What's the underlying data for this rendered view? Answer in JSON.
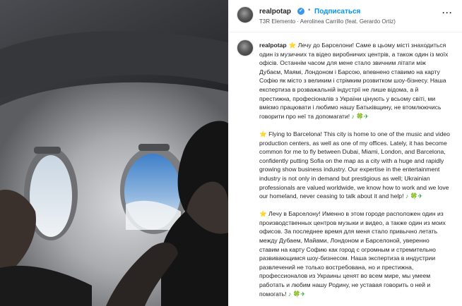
{
  "post": {
    "username": "realpotap",
    "verified_icon": "verified-badge-icon",
    "separator": "•",
    "follow_label": "Подписаться",
    "audio_label": "T3R Elemento · Aerolinea Carrillo (feat. Gerardo Ortiz)",
    "more_label": "···"
  },
  "caption": {
    "username": "realpotap",
    "paragraphs": [
      {
        "lead": "⭐",
        "text": " Лечу до Барселони! Саме в цьому місті знаходиться один із музичних та відео виробничих центрів, а також один із моїх офісів. Останнім часом для мене стало звичним літати між Дубаєм, Маямі, Лондоном і Барсою, впевнено ставимо на карту Софію як місто з великим і стрімким розвитком шоу-бізнесу. Наша експертиза в розважальній індустрії не лише відома, а й престижна, професіоналів з України цінують у всьому світі, ми вміємо працювати і любимо нашу Батьківщину, не втомлюючись говорити про неї та допомагати! ",
        "tail": "♪ 🍀✈"
      },
      {
        "lead": "⭐",
        "text": " Flying to Barcelona! This city is home to one of the music and video production centers, as well as one of my offices. Lately, it has become common for me to fly between Dubai, Miami, London, and Barcelona, confidently putting Sofia on the map as a city with a huge and rapidly growing show business industry. Our expertise in the entertainment industry is not only in demand but prestigious as well; Ukrainian professionals are valued worldwide, we know how to work and we love our homeland, never ceasing to talk about it and help! ",
        "tail": "♪ 🍀✈"
      },
      {
        "lead": "⭐",
        "text": " Лечу в Барселону! Именно в этом городе расположен один из производственных центров музыки и видео, а также один из моих офисов. За последнее время для меня стало привычно летать между Дубаем, Майами, Лондоном и Барселоной, уверенно ставим на карту Софию как город с огромным и стремительно развивающимся шоу-бизнесом. Наша экспертиза в индустрии развлечений не только востребована, но и престижна, профессионалов из Украины ценят во всем мире, мы умеем работать и любим нашу Родину, не уставая говорить о ней и помогать! ",
        "tail": "♪ 🍀✈"
      }
    ]
  },
  "colors": {
    "accent": "#0095f6",
    "verified": "#3897f0",
    "text": "#262626"
  }
}
